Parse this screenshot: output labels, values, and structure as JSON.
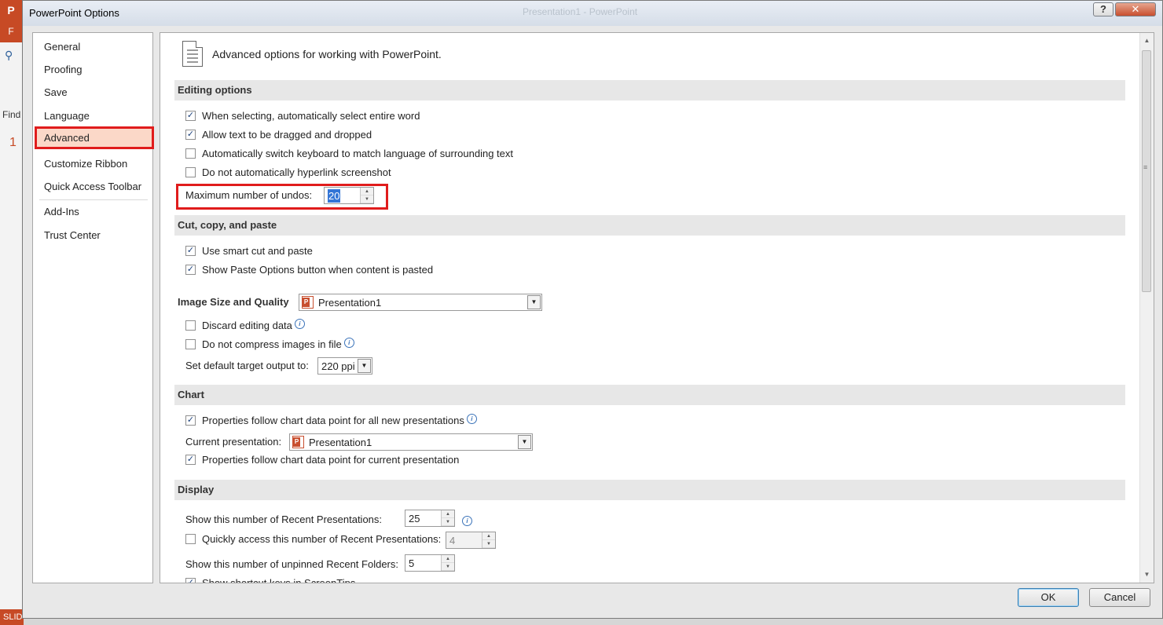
{
  "background_app": {
    "logo": "P",
    "ribbon_tab": "F",
    "find_label": "Find",
    "slide_number": "1",
    "status_text": "SLID"
  },
  "dialog": {
    "title": "PowerPoint Options",
    "ghost_title": "Presentation1 - PowerPoint",
    "help_label": "?",
    "close_label": "✕"
  },
  "nav": {
    "items": [
      {
        "label": "General"
      },
      {
        "label": "Proofing"
      },
      {
        "label": "Save"
      },
      {
        "label": "Language"
      },
      {
        "label": "Advanced"
      },
      {
        "label": "Customize Ribbon"
      },
      {
        "label": "Quick Access Toolbar"
      },
      {
        "label": "Add-Ins"
      },
      {
        "label": "Trust Center"
      }
    ],
    "selected": "Advanced"
  },
  "content": {
    "header": "Advanced options for working with PowerPoint.",
    "editing": {
      "title": "Editing options",
      "opt1": "When selecting, automatically select entire word",
      "opt2": "Allow text to be dragged and dropped",
      "opt3": "Automatically switch keyboard to match language of surrounding text",
      "opt4": "Do not automatically hyperlink screenshot",
      "undos_label": "Maximum number of undos:",
      "undos_value": "20"
    },
    "cut": {
      "title": "Cut, copy, and paste",
      "opt1": "Use smart cut and paste",
      "opt2": "Show Paste Options button when content is pasted"
    },
    "image": {
      "title": "Image Size and Quality",
      "presentation": "Presentation1",
      "opt1": "Discard editing data",
      "opt2": "Do not compress images in file",
      "target_label": "Set default target output to:",
      "target_value": "220 ppi"
    },
    "chart": {
      "title": "Chart",
      "opt1": "Properties follow chart data point for all new presentations",
      "current_label": "Current presentation:",
      "current_value": "Presentation1",
      "opt2": "Properties follow chart data point for current presentation"
    },
    "display": {
      "title": "Display",
      "recent_label": "Show this number of Recent Presentations:",
      "recent_value": "25",
      "quick_label": "Quickly access this number of Recent Presentations:",
      "quick_value": "4",
      "folders_label": "Show this number of unpinned Recent Folders:",
      "folders_value": "5",
      "shortcut_label": "Show shortcut keys in ScreenTips"
    }
  },
  "footer": {
    "ok": "OK",
    "cancel": "Cancel"
  },
  "colors": {
    "accent_red": "#e01c1c",
    "selection_blue": "#3375d6",
    "brand_orange": "#c74a25"
  }
}
